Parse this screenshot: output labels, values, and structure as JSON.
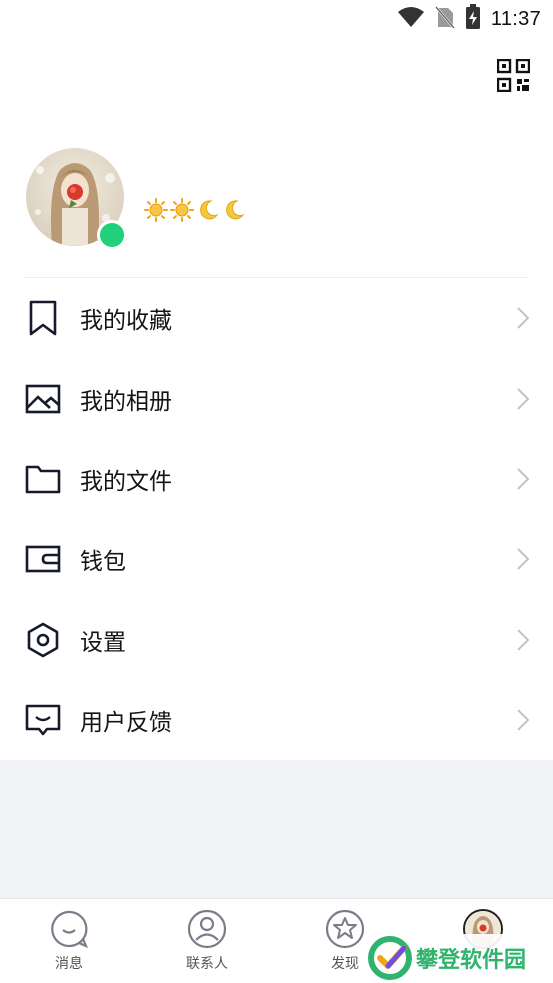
{
  "status_bar": {
    "time": "11:37",
    "icons": [
      "wifi-icon",
      "no-sim-icon",
      "battery-charging-icon"
    ]
  },
  "header": {
    "qr_icon": "qr-code-icon"
  },
  "profile": {
    "status": "online",
    "status_color": "#21d07a",
    "level_icons": [
      "sun-icon",
      "sun-icon",
      "moon-icon",
      "moon-icon"
    ]
  },
  "menu": {
    "items": [
      {
        "label": "我的收藏",
        "icon": "bookmark-icon"
      },
      {
        "label": "我的相册",
        "icon": "photo-album-icon"
      },
      {
        "label": "我的文件",
        "icon": "folder-icon"
      },
      {
        "label": "钱包",
        "icon": "wallet-icon"
      },
      {
        "label": "设置",
        "icon": "settings-hexagon-icon"
      },
      {
        "label": "用户反馈",
        "icon": "feedback-icon"
      }
    ]
  },
  "bottom_nav": {
    "items": [
      {
        "label": "消息",
        "icon": "message-icon"
      },
      {
        "label": "联系人",
        "icon": "contacts-icon"
      },
      {
        "label": "发现",
        "icon": "discover-icon"
      },
      {
        "label": "",
        "icon": "profile-avatar-icon",
        "active": true
      }
    ]
  },
  "watermark": {
    "text": "攀登软件园",
    "color": "#2fb36d"
  }
}
